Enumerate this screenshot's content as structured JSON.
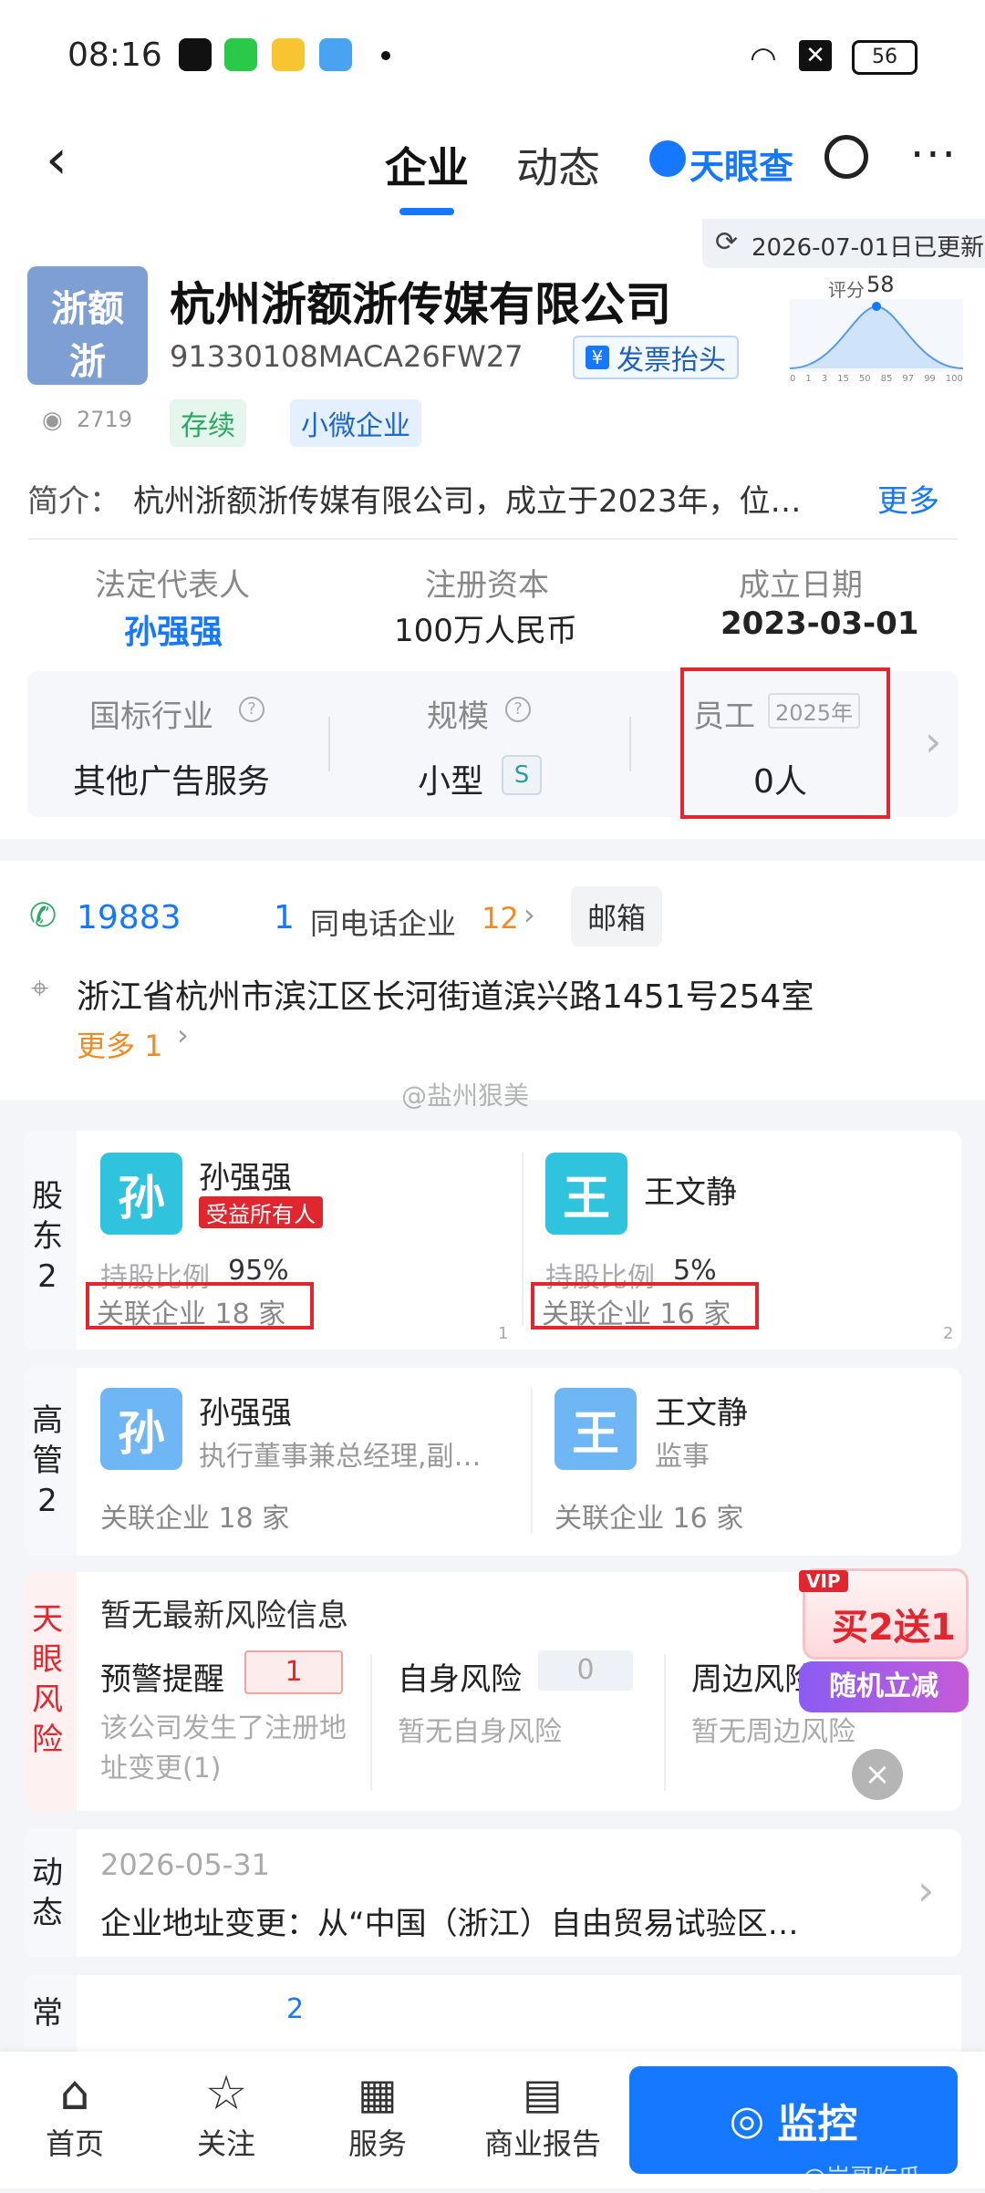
{
  "status_bar": {
    "time": "08:16",
    "battery": "56"
  },
  "header": {
    "tabs": [
      "企业",
      "动态"
    ],
    "brand": "天眼查"
  },
  "company": {
    "updated": "2026-07-01日已更新",
    "logo_text_1": "浙额",
    "logo_text_2": "浙",
    "name": "杭州浙额浙传媒有限公司",
    "credit_code": "91330108MACA26FW27",
    "invoice_btn": "发票抬头",
    "views": "2719",
    "status_tag": "存续",
    "size_tag": "小微企业",
    "score_label": "评分",
    "score": "58",
    "score_axis": [
      "0",
      "1",
      "3",
      "15",
      "50",
      "85",
      "97",
      "99",
      "100"
    ],
    "intro_label": "简介：",
    "intro": "杭州浙额浙传媒有限公司，成立于2023年，位…",
    "more": "更多"
  },
  "basic": {
    "legal_label": "法定代表人",
    "legal_value": "孙强强",
    "capital_label": "注册资本",
    "capital_value": "100万人民币",
    "date_label": "成立日期",
    "date_value": "2023-03-01"
  },
  "industry": {
    "industry_label": "国标行业",
    "industry_value": "其他广告服务",
    "scale_label": "规模",
    "scale_value": "小型",
    "scale_badge": "S",
    "staff_label": "员工",
    "staff_year": "2025年",
    "staff_value": "0人"
  },
  "contact": {
    "phone": "19883",
    "phone_tail": "1",
    "same_phone_label": "同电话企业",
    "same_phone_count": "12",
    "email_btn": "邮箱",
    "address": "浙江省杭州市滨江区长河街道滨兴路1451号254室",
    "more": "更多 1"
  },
  "watermark": "@盐州狠美",
  "shareholders": {
    "label": "股东",
    "count": "2",
    "items": [
      {
        "avatar": "孙",
        "name": "孙强强",
        "badge": "受益所有人",
        "ratio_label": "持股比例",
        "ratio": "95%",
        "related": "关联企业 18 家",
        "index": "1"
      },
      {
        "avatar": "王",
        "name": "王文静",
        "badge": "",
        "ratio_label": "持股比例",
        "ratio": "5%",
        "related": "关联企业 16 家",
        "index": "2"
      }
    ]
  },
  "executives": {
    "label": "高管",
    "count": "2",
    "items": [
      {
        "avatar": "孙",
        "name": "孙强强",
        "role": "执行董事兼总经理,副…",
        "related": "关联企业 18 家"
      },
      {
        "avatar": "王",
        "name": "王文静",
        "role": "监事",
        "related": "关联企业 16 家"
      }
    ]
  },
  "risk": {
    "label": "天眼风险",
    "header": "暂无最新风险信息",
    "col1_title": "预警提醒",
    "col1_count": "1",
    "col1_desc": "该公司发生了注册地址变更(1)",
    "col2_title": "自身风险",
    "col2_count": "0",
    "col2_desc": "暂无自身风险",
    "col3_title": "周边风险",
    "col3_desc": "暂无周边风险"
  },
  "promo": {
    "vip": "VIP",
    "line1": "买2送1",
    "line2": "随机立减"
  },
  "dynamic": {
    "label": "动态",
    "date": "2026-05-31",
    "text": "企业地址变更：从“中国（浙江）自由贸易试验区…"
  },
  "common": {
    "label": "常用",
    "badge": "2"
  },
  "bottom_nav": {
    "items": [
      "首页",
      "关注",
      "服务",
      "商业报告"
    ],
    "monitor": "监控",
    "watermark": "@岩哥吃瓜"
  },
  "colors": {
    "accent": "#1677ff",
    "red": "#e0262e",
    "orange": "#f08a24",
    "green": "#2aa866"
  }
}
